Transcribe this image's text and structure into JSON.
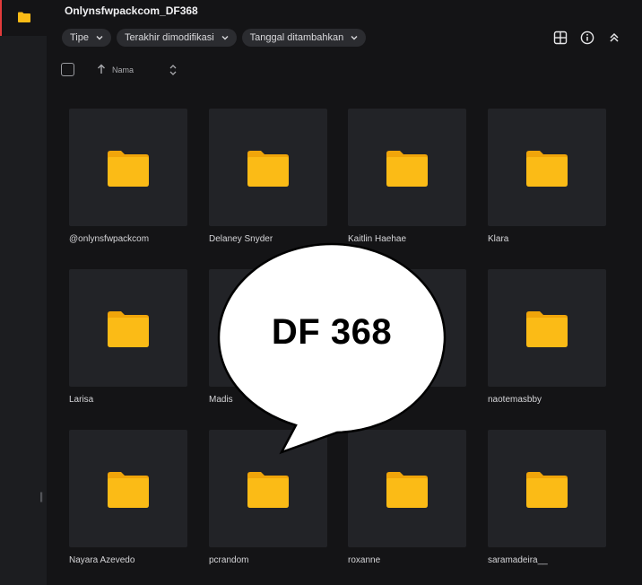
{
  "window": {
    "title": "Onlynsfwpackcom_DF368"
  },
  "filters": [
    {
      "label": "Tipe"
    },
    {
      "label": "Terakhir dimodifikasi"
    },
    {
      "label": "Tanggal ditambahkan"
    }
  ],
  "toolbar": {
    "icons": [
      "grid-view-icon",
      "info-icon",
      "collapse-icon"
    ]
  },
  "sort": {
    "label": "Nama"
  },
  "folders": [
    {
      "name": "@onlynsfwpackcom"
    },
    {
      "name": "Delaney Snyder"
    },
    {
      "name": "Kaitlin Haehae"
    },
    {
      "name": "Klara"
    },
    {
      "name": "Larisa"
    },
    {
      "name": "Madis"
    },
    {
      "name": ""
    },
    {
      "name": "naotemasbby"
    },
    {
      "name": "Nayara Azevedo"
    },
    {
      "name": "pcrandom"
    },
    {
      "name": "roxanne"
    },
    {
      "name": "saramadeira__"
    }
  ],
  "overlay": {
    "text": "DF 368"
  },
  "colors": {
    "folder": "#fbbb16",
    "folder_dark": "#f0a50a",
    "accent": "#e23b3b"
  }
}
